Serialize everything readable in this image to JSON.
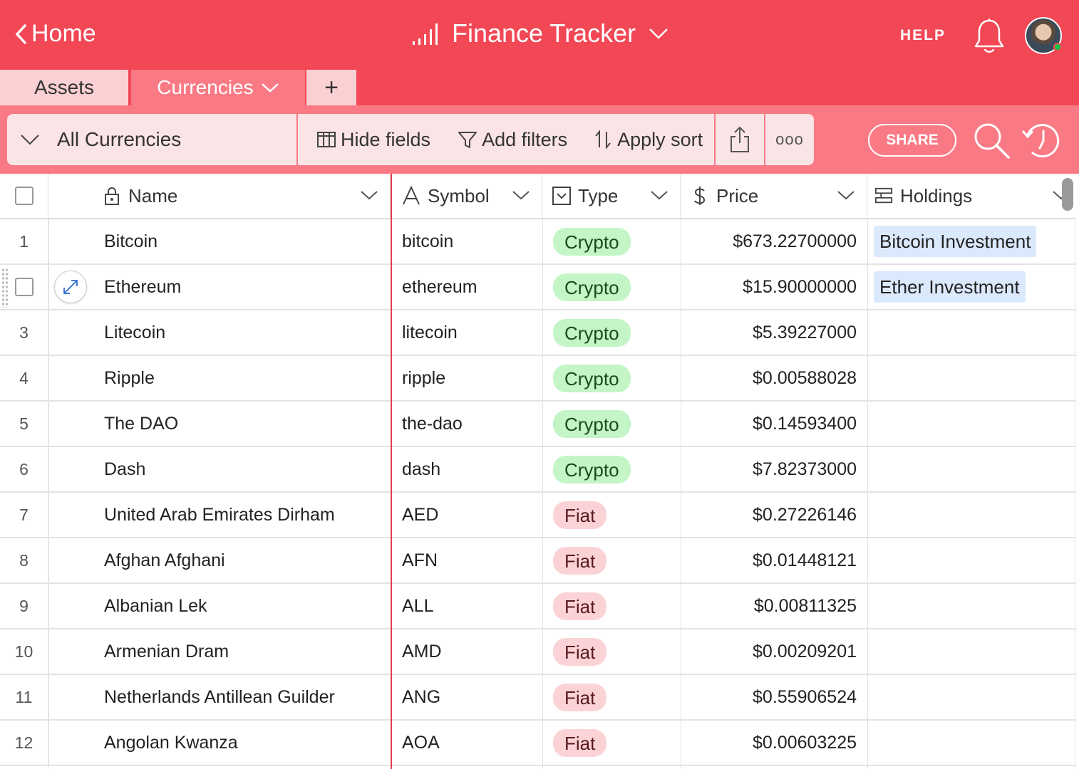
{
  "header": {
    "back_label": "Home",
    "app_title": "Finance Tracker",
    "help_label": "HELP"
  },
  "tabs": {
    "assets": "Assets",
    "currencies": "Currencies",
    "add": "+"
  },
  "toolbar": {
    "view_name": "All Currencies",
    "hide_fields": "Hide fields",
    "add_filters": "Add filters",
    "apply_sort": "Apply sort",
    "more": "ooo",
    "share": "SHARE"
  },
  "columns": {
    "name": "Name",
    "symbol": "Symbol",
    "type": "Type",
    "price": "Price",
    "holdings": "Holdings"
  },
  "colors": {
    "brand": "#f24755",
    "toolbar": "#f97a85",
    "crypto_pill": "#c3f5c6",
    "fiat_pill": "#fbd3d6",
    "link_chip": "#dbe9fd"
  },
  "rows": [
    {
      "num": "1",
      "name": "Bitcoin",
      "symbol": "bitcoin",
      "type": "Crypto",
      "price": "$673.22700000",
      "holdings": "Bitcoin Investment"
    },
    {
      "num": "",
      "name": "Ethereum",
      "symbol": "ethereum",
      "type": "Crypto",
      "price": "$15.90000000",
      "holdings": "Ether Investment"
    },
    {
      "num": "3",
      "name": "Litecoin",
      "symbol": "litecoin",
      "type": "Crypto",
      "price": "$5.39227000",
      "holdings": ""
    },
    {
      "num": "4",
      "name": "Ripple",
      "symbol": "ripple",
      "type": "Crypto",
      "price": "$0.00588028",
      "holdings": ""
    },
    {
      "num": "5",
      "name": "The DAO",
      "symbol": "the-dao",
      "type": "Crypto",
      "price": "$0.14593400",
      "holdings": ""
    },
    {
      "num": "6",
      "name": "Dash",
      "symbol": "dash",
      "type": "Crypto",
      "price": "$7.82373000",
      "holdings": ""
    },
    {
      "num": "7",
      "name": "United Arab Emirates Dirham",
      "symbol": "AED",
      "type": "Fiat",
      "price": "$0.27226146",
      "holdings": ""
    },
    {
      "num": "8",
      "name": "Afghan Afghani",
      "symbol": "AFN",
      "type": "Fiat",
      "price": "$0.01448121",
      "holdings": ""
    },
    {
      "num": "9",
      "name": "Albanian Lek",
      "symbol": "ALL",
      "type": "Fiat",
      "price": "$0.00811325",
      "holdings": ""
    },
    {
      "num": "10",
      "name": "Armenian Dram",
      "symbol": "AMD",
      "type": "Fiat",
      "price": "$0.00209201",
      "holdings": ""
    },
    {
      "num": "11",
      "name": "Netherlands Antillean Guilder",
      "symbol": "ANG",
      "type": "Fiat",
      "price": "$0.55906524",
      "holdings": ""
    },
    {
      "num": "12",
      "name": "Angolan Kwanza",
      "symbol": "AOA",
      "type": "Fiat",
      "price": "$0.00603225",
      "holdings": ""
    }
  ]
}
